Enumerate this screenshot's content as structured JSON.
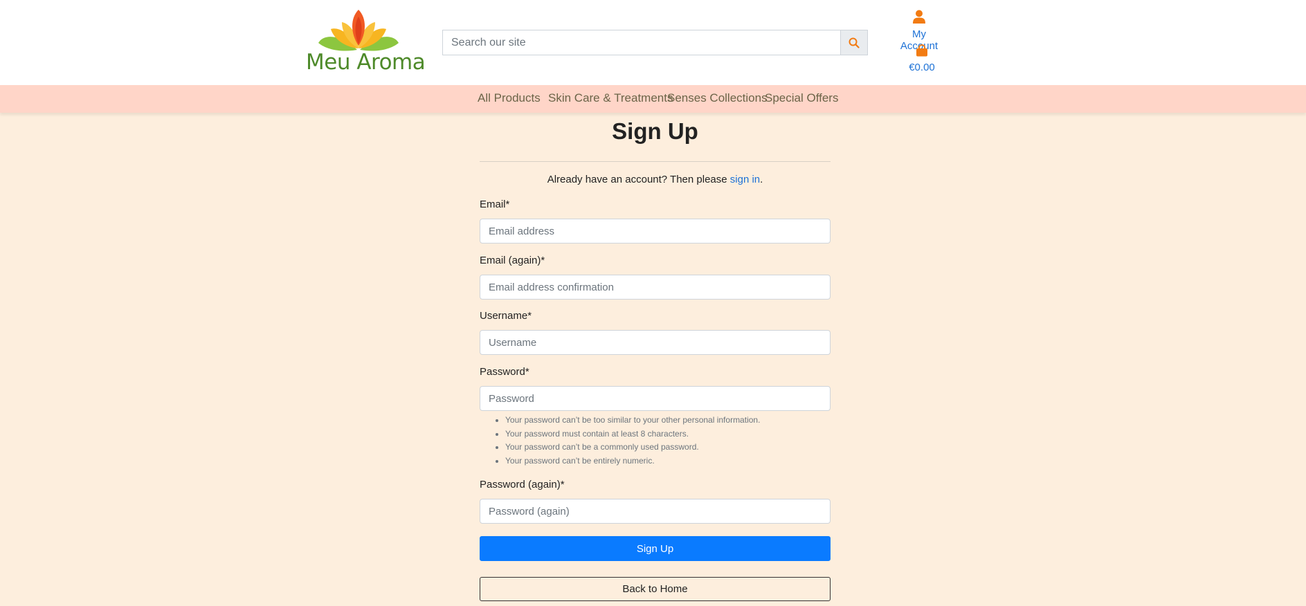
{
  "brand": {
    "name": "Meu Aroma",
    "colors": {
      "leaf_green": "#8cc63f",
      "petal_yellow": "#f7b521",
      "petal_red": "#f15a24",
      "text_green": "#4e8a2a"
    }
  },
  "search": {
    "placeholder": "Search our site",
    "icon": "search-icon"
  },
  "account": {
    "label": "My Account",
    "icon": "user-icon"
  },
  "cart": {
    "amount": "€0.00",
    "icon": "shopping-bag-icon"
  },
  "nav": {
    "items": [
      {
        "label": "All Products"
      },
      {
        "label": "Skin Care & Treatments"
      },
      {
        "label": "Senses Collections"
      },
      {
        "label": "Special Offers"
      }
    ]
  },
  "signup": {
    "title": "Sign Up",
    "already_text": "Already have an account? Then please ",
    "signin_link": "sign in",
    "period": ".",
    "fields": [
      {
        "label": "Email*",
        "placeholder": "Email address"
      },
      {
        "label": "Email (again)*",
        "placeholder": "Email address confirmation"
      },
      {
        "label": "Username*",
        "placeholder": "Username"
      },
      {
        "label": "Password*",
        "placeholder": "Password"
      },
      {
        "label": "Password (again)*",
        "placeholder": "Password (again)"
      }
    ],
    "password_help": [
      "Your password can’t be too similar to your other personal information.",
      "Your password must contain at least 8 characters.",
      "Your password can’t be a commonly used password.",
      "Your password can’t be entirely numeric."
    ],
    "submit_label": "Sign Up",
    "back_label": "Back to Home"
  },
  "colors": {
    "page_bg": "#fdeedd",
    "nav_bg": "#ffd5c8",
    "link_blue": "#1e72d6",
    "accent_orange": "#f27b12",
    "primary_button": "#0a7bff"
  }
}
